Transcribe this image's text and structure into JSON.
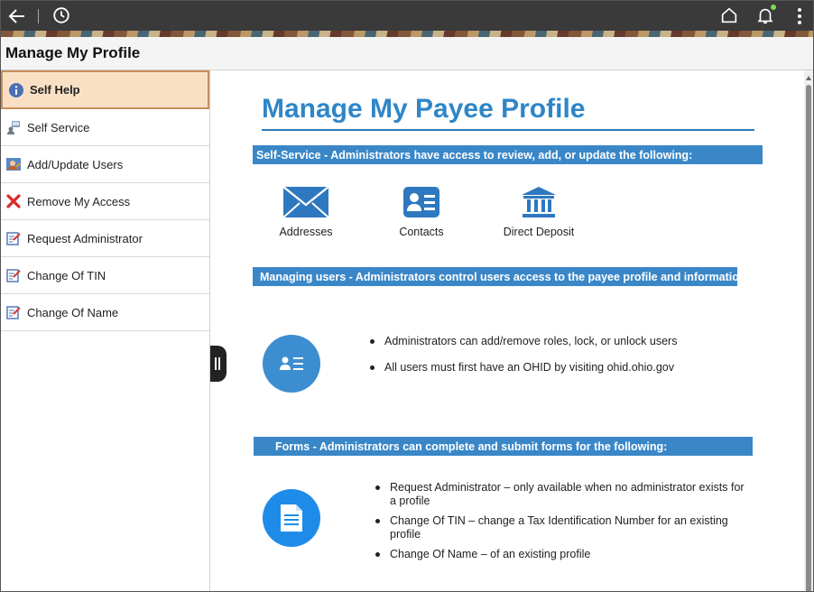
{
  "page": {
    "title": "Manage My Profile"
  },
  "sidebar": {
    "items": [
      {
        "label": "Self Help",
        "icon": "info-icon"
      },
      {
        "label": "Self Service",
        "icon": "self-service-icon"
      },
      {
        "label": "Add/Update Users",
        "icon": "users-icon"
      },
      {
        "label": "Remove My Access",
        "icon": "red-x-icon"
      },
      {
        "label": "Request Administrator",
        "icon": "form-edit-icon"
      },
      {
        "label": "Change Of TIN",
        "icon": "form-edit-icon"
      },
      {
        "label": "Change Of Name",
        "icon": "form-edit-icon"
      }
    ]
  },
  "content": {
    "heading": "Manage My Payee Profile",
    "self_service_band": "Self-Service - Administrators have access to review, add, or update the following:",
    "services": [
      {
        "label": "Addresses",
        "icon": "envelope-icon"
      },
      {
        "label": "Contacts",
        "icon": "contact-card-icon"
      },
      {
        "label": "Direct Deposit",
        "icon": "bank-icon"
      }
    ],
    "managing_band": "Managing users - Administrators control users access to the payee profile and information:",
    "managing_points": [
      "Administrators can add/remove roles, lock, or unlock users",
      "All users must first have an OHID by visiting ohid.ohio.gov"
    ],
    "forms_band": "Forms - Administrators can complete and submit forms for the following:",
    "forms_points": [
      "Request Administrator – only available when no administrator exists for a profile",
      "Change Of TIN – change a Tax Identification Number for an existing profile",
      "Change Of Name – of an existing profile"
    ]
  },
  "colors": {
    "accent": "#2e86c8",
    "active_nav_bg": "#f9e0c4",
    "active_nav_border": "#c98e5a",
    "topbar": "#3a3a3a"
  }
}
